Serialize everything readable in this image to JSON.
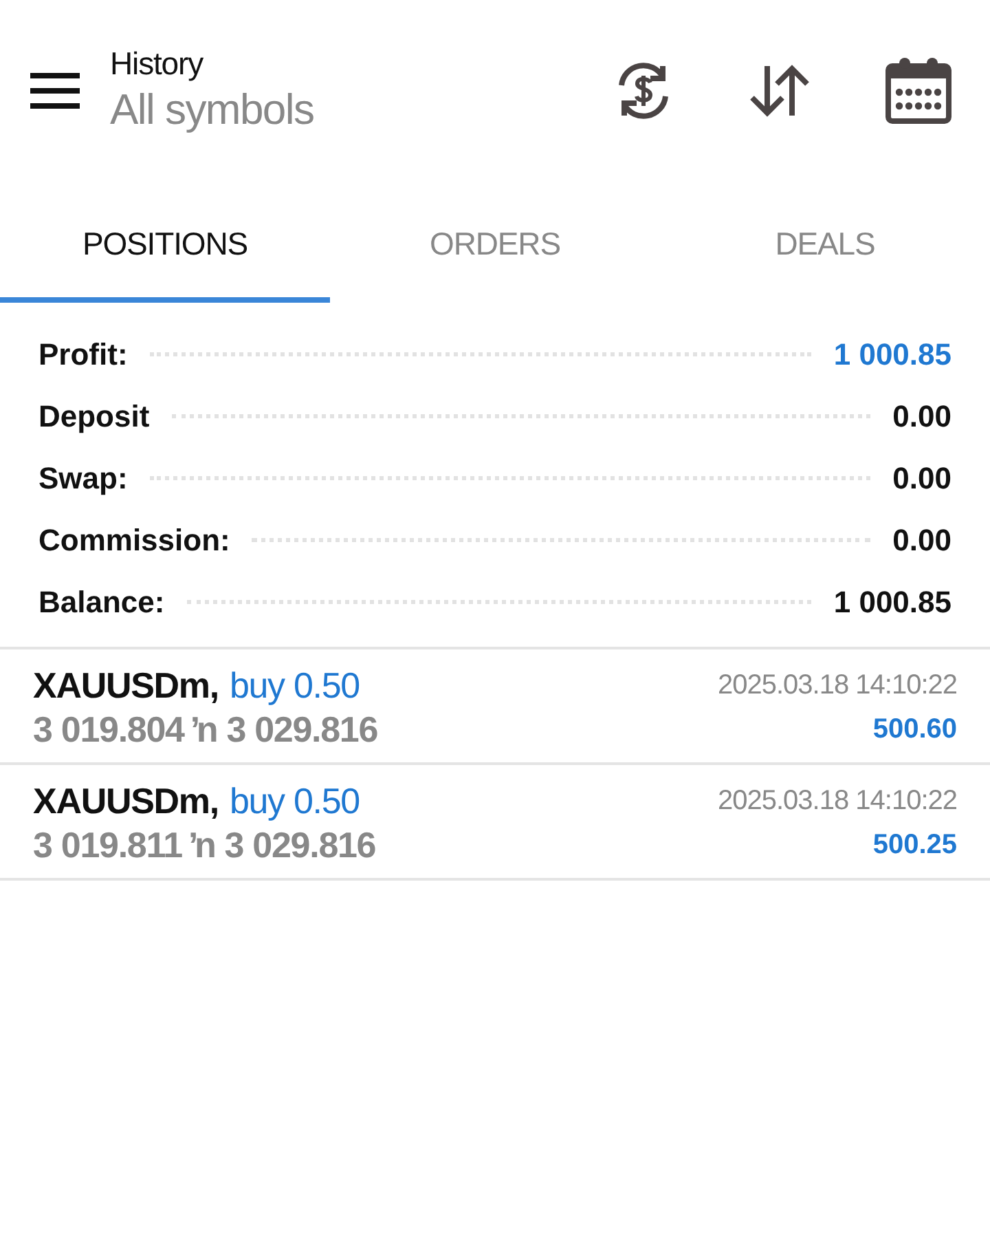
{
  "header": {
    "title": "History",
    "subtitle": "All symbols"
  },
  "tabs": [
    {
      "label": "POSITIONS",
      "selected": true
    },
    {
      "label": "ORDERS",
      "selected": false
    },
    {
      "label": "DEALS",
      "selected": false
    }
  ],
  "summary": [
    {
      "label": "Profit:",
      "value": "1 000.85",
      "accent": true
    },
    {
      "label": "Deposit",
      "value": "0.00",
      "accent": false
    },
    {
      "label": "Swap:",
      "value": "0.00",
      "accent": false
    },
    {
      "label": "Commission:",
      "value": "0.00",
      "accent": false
    },
    {
      "label": "Balance:",
      "value": "1 000.85",
      "accent": false
    }
  ],
  "positions": [
    {
      "symbol": "XAUUSDm,",
      "side": "buy 0.50",
      "prices": "3 019.804 ŉ 3 029.816",
      "time": "2025.03.18 14:10:22",
      "profit": "500.60"
    },
    {
      "symbol": "XAUUSDm,",
      "side": "buy 0.50",
      "prices": "3 019.811 ŉ 3 029.816",
      "time": "2025.03.18 14:10:22",
      "profit": "500.25"
    }
  ]
}
